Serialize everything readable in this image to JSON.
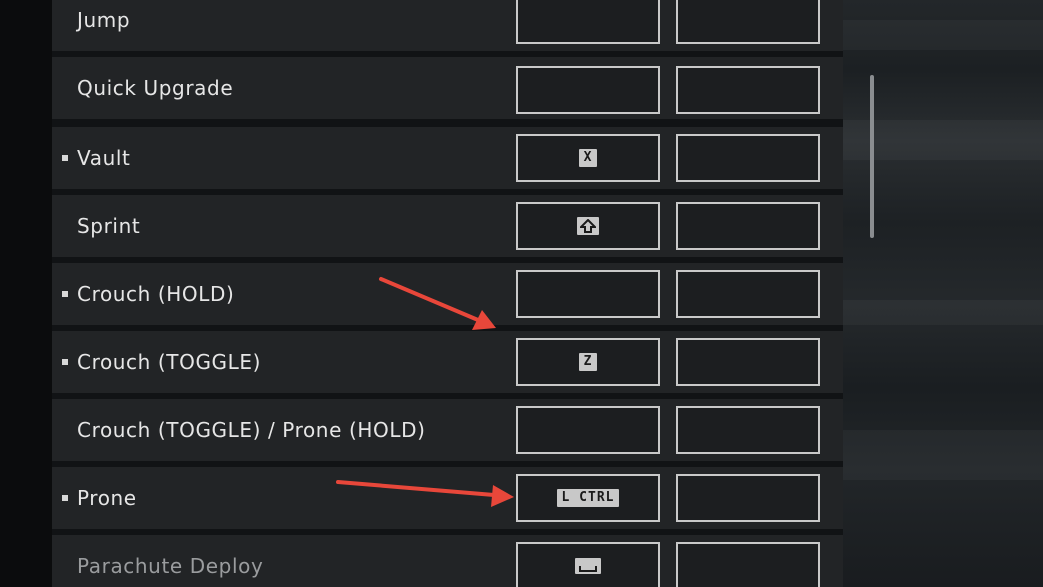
{
  "bindings": [
    {
      "action": "Jump",
      "marked": false,
      "dim": false,
      "primary_key": "",
      "secondary_key": ""
    },
    {
      "action": "Quick Upgrade",
      "marked": false,
      "dim": false,
      "primary_key": "",
      "secondary_key": ""
    },
    {
      "action": "Vault",
      "marked": true,
      "dim": false,
      "primary_key": "X",
      "secondary_key": ""
    },
    {
      "action": "Sprint",
      "marked": false,
      "dim": false,
      "primary_key": "shift-icon",
      "secondary_key": ""
    },
    {
      "action": "Crouch (HOLD)",
      "marked": true,
      "dim": false,
      "primary_key": "",
      "secondary_key": ""
    },
    {
      "action": "Crouch (TOGGLE)",
      "marked": true,
      "dim": false,
      "primary_key": "Z",
      "secondary_key": ""
    },
    {
      "action": "Crouch (TOGGLE) / Prone (HOLD)",
      "marked": false,
      "dim": false,
      "primary_key": "",
      "secondary_key": ""
    },
    {
      "action": "Prone",
      "marked": true,
      "dim": false,
      "primary_key": "L CTRL",
      "secondary_key": ""
    },
    {
      "action": "Parachute Deploy",
      "marked": false,
      "dim": true,
      "primary_key": "space-icon",
      "secondary_key": ""
    }
  ],
  "colors": {
    "row_bg": "#222426",
    "slot_border": "#c9c9c9",
    "keycap_bg": "#c8c8c8",
    "annotation_arrow": "#e8473a"
  },
  "icons": {
    "marker": "square-bullet-icon",
    "shift": "shift-arrow-icon",
    "space": "spacebar-icon"
  }
}
